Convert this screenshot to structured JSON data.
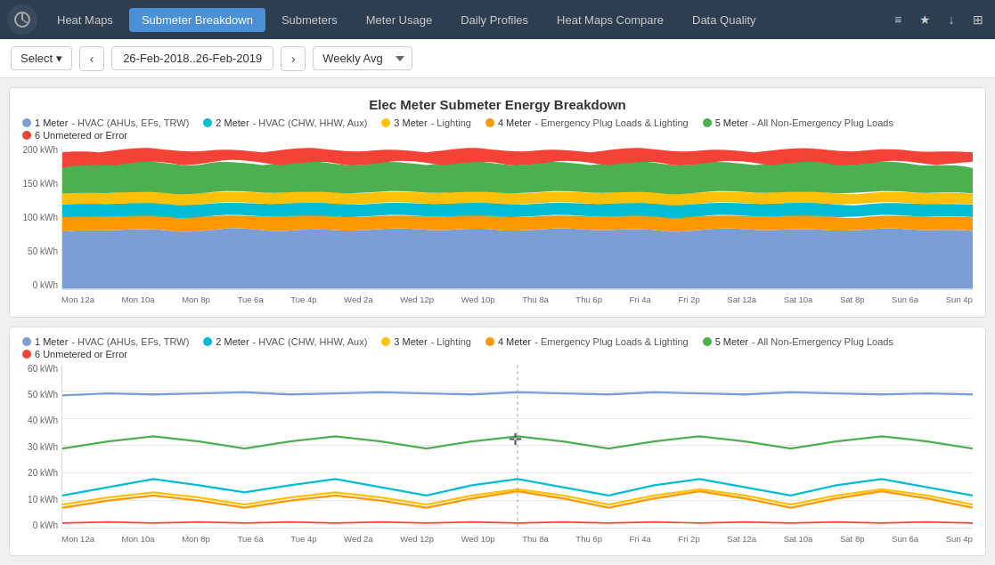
{
  "nav": {
    "tabs": [
      {
        "label": "Heat Maps",
        "active": false
      },
      {
        "label": "Submeter Breakdown",
        "active": true
      },
      {
        "label": "Submeters",
        "active": false
      },
      {
        "label": "Meter Usage",
        "active": false
      },
      {
        "label": "Daily Profiles",
        "active": false
      },
      {
        "label": "Heat Maps Compare",
        "active": false
      },
      {
        "label": "Data Quality",
        "active": false
      }
    ],
    "icons": [
      "≡",
      "★",
      "↓",
      "⊞"
    ]
  },
  "toolbar": {
    "select_label": "Select",
    "date_range": "26-Feb-2018..26-Feb-2019",
    "period": "Weekly Avg"
  },
  "chart1": {
    "title": "Elec Meter Submeter Energy Breakdown",
    "legend": [
      {
        "color": "#7b9fd4",
        "label": "1 Meter",
        "desc": "- HVAC (AHUs, EFs, TRW)"
      },
      {
        "color": "#00bcd4",
        "label": "2 Meter",
        "desc": "- HVAC (CHW, HHW, Aux)"
      },
      {
        "color": "#ffc107",
        "label": "3 Meter",
        "desc": "- Lighting"
      },
      {
        "color": "#ff9800",
        "label": "4 Meter",
        "desc": "- Emergency Plug Loads & Lighting"
      },
      {
        "color": "#4caf50",
        "label": "5 Meter",
        "desc": "- All Non-Emergency Plug Loads"
      },
      {
        "color": "#f44336",
        "label": "6 Unmetered or Error",
        "desc": ""
      }
    ],
    "y_labels": [
      "200 kWh",
      "150 kWh",
      "100 kWh",
      "50 kWh",
      "0 kWh"
    ],
    "x_labels": [
      "Mon 12a",
      "Mon 10a",
      "Mon 8p",
      "Tue 6a",
      "Tue 4p",
      "Wed 2a",
      "Wed 12p",
      "Wed 10p",
      "Thu 8a",
      "Thu 6p",
      "Fri 4a",
      "Fri 2p",
      "Sat 12a",
      "Sat 10a",
      "Sat 8p",
      "Sun 6a",
      "Sun 4p"
    ]
  },
  "chart2": {
    "legend": [
      {
        "color": "#7b9fd4",
        "label": "1 Meter",
        "desc": "- HVAC (AHUs, EFs, TRW)"
      },
      {
        "color": "#00bcd4",
        "label": "2 Meter",
        "desc": "- HVAC (CHW, HHW, Aux)"
      },
      {
        "color": "#ffc107",
        "label": "3 Meter",
        "desc": "- Lighting"
      },
      {
        "color": "#ff9800",
        "label": "4 Meter",
        "desc": "- Emergency Plug Loads & Lighting"
      },
      {
        "color": "#4caf50",
        "label": "5 Meter",
        "desc": "- All Non-Emergency Plug Loads"
      },
      {
        "color": "#f44336",
        "label": "6 Unmetered or Error",
        "desc": ""
      }
    ],
    "y_labels": [
      "60 kWh",
      "50 kWh",
      "40 kWh",
      "30 kWh",
      "20 kWh",
      "10 kWh",
      "0 kWh"
    ],
    "x_labels": [
      "Mon 12a",
      "Mon 10a",
      "Mon 8p",
      "Tue 6a",
      "Tue 4p",
      "Wed 2a",
      "Wed 12p",
      "Wed 10p",
      "Thu 8a",
      "Thu 6p",
      "Fri 4a",
      "Fri 2p",
      "Sat 12a",
      "Sat 10a",
      "Sat 8p",
      "Sun 6a",
      "Sun 4p"
    ]
  }
}
